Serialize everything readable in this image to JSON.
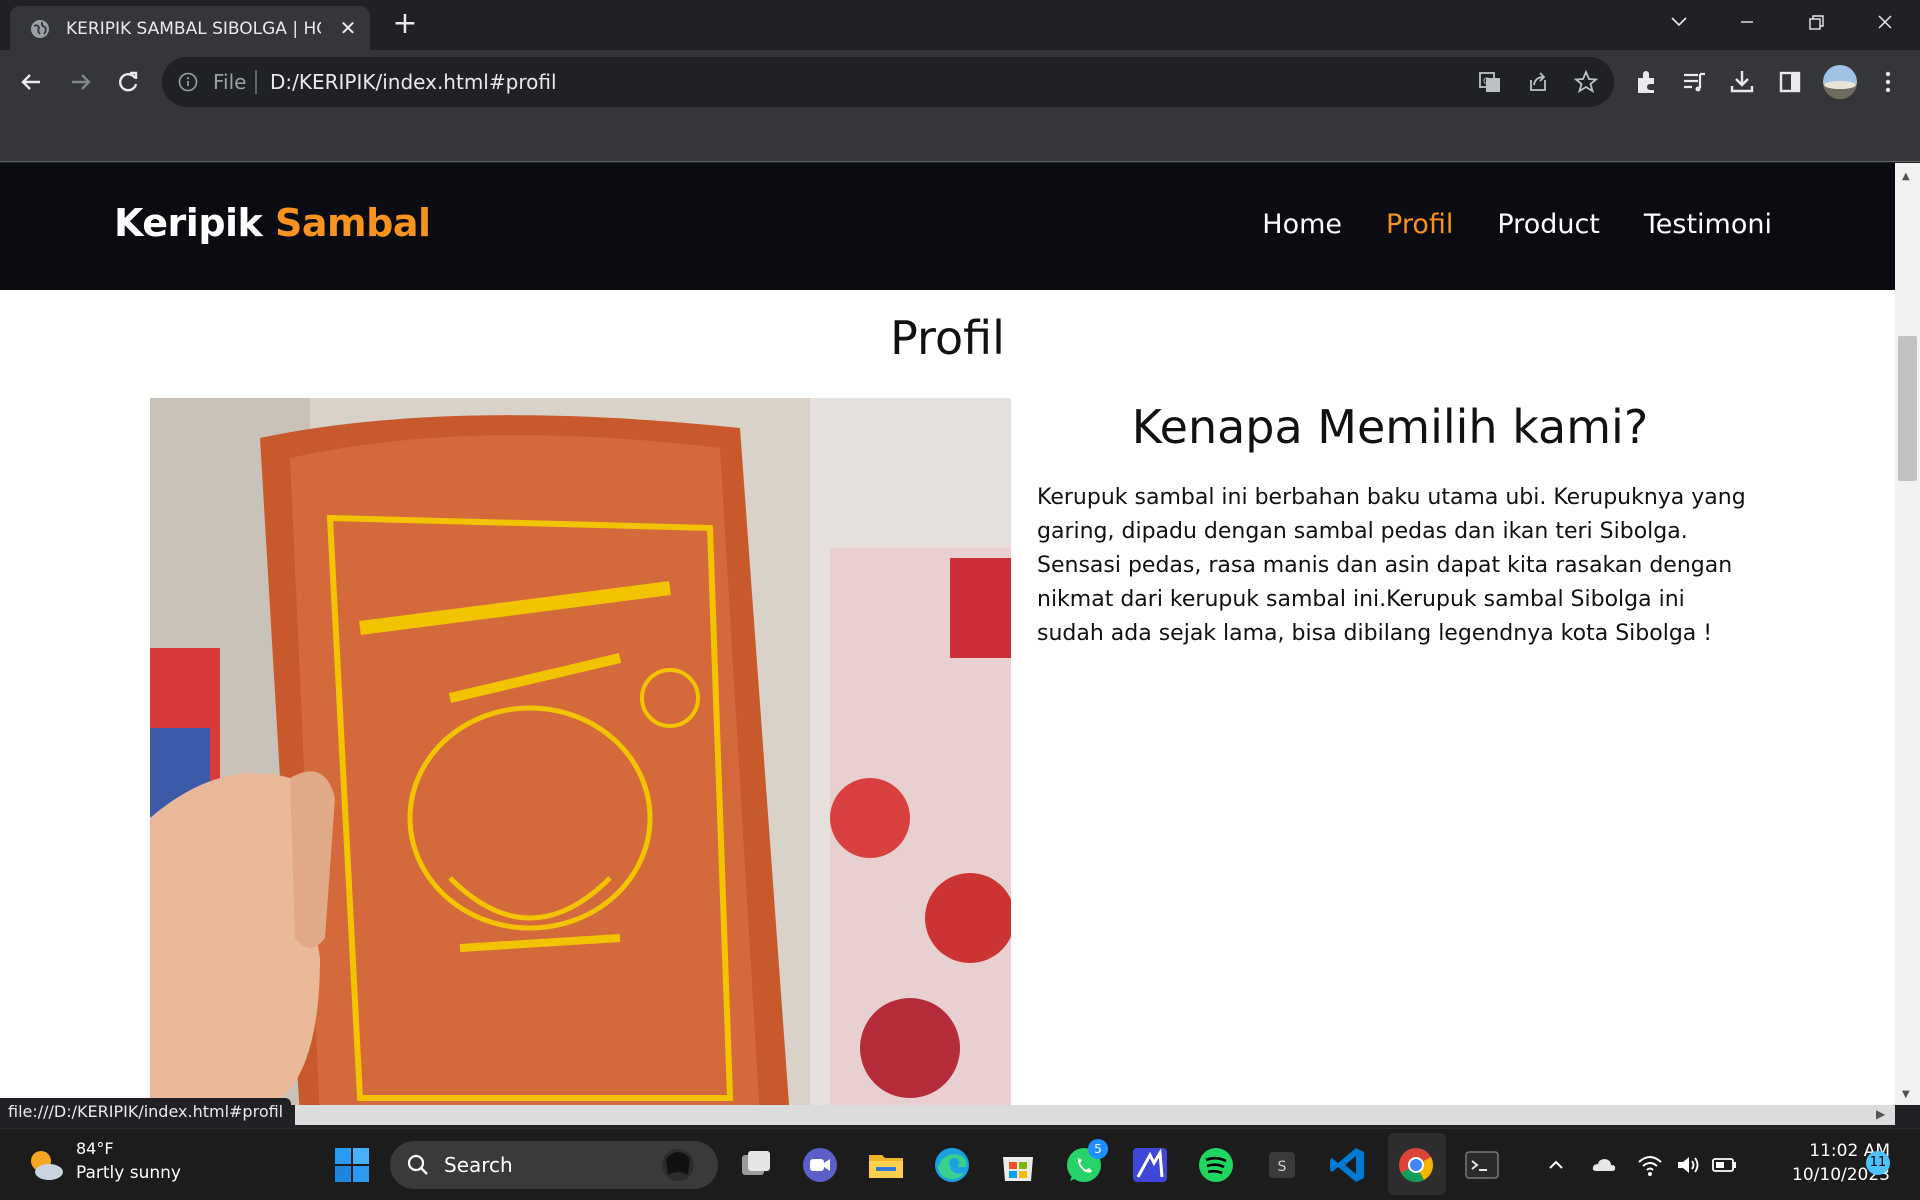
{
  "browser": {
    "tab_title": "KERIPIK SAMBAL SIBOLGA | HOME",
    "tab_close": "✕",
    "new_tab": "+",
    "scheme_label": "File",
    "url": "D:/KERIPIK/index.html#profil",
    "status_url": "file:///D:/KERIPIK/index.html#profil"
  },
  "site": {
    "brand_main": "Keripik ",
    "brand_accent": "Sambal",
    "nav": [
      {
        "label": "Home"
      },
      {
        "label": "Profil"
      },
      {
        "label": "Product"
      },
      {
        "label": "Testimoni"
      }
    ],
    "accent_color": "#f7931e",
    "nav_bg": "#0b0b12"
  },
  "profil": {
    "section_title": "Profil",
    "heading": "Kenapa Memilih kami?",
    "body": "Kerupuk sambal ini berbahan baku utama ubi. Kerupuknya yang garing, dipadu dengan sambal pedas dan ikan teri Sibolga. Sensasi pedas, rasa manis dan asin dapat kita rasakan dengan nikmat dari kerupuk sambal ini.Kerupuk sambal Sibolga ini sudah ada sejak lama, bisa dibilang legendnya kota Sibolga !"
  },
  "taskbar": {
    "weather_temp": "84°F",
    "weather_desc": "Partly sunny",
    "search_label": "Search",
    "whatsapp_badge": "5",
    "time": "11:02 AM",
    "date": "10/10/2023",
    "notification_count": "11"
  }
}
